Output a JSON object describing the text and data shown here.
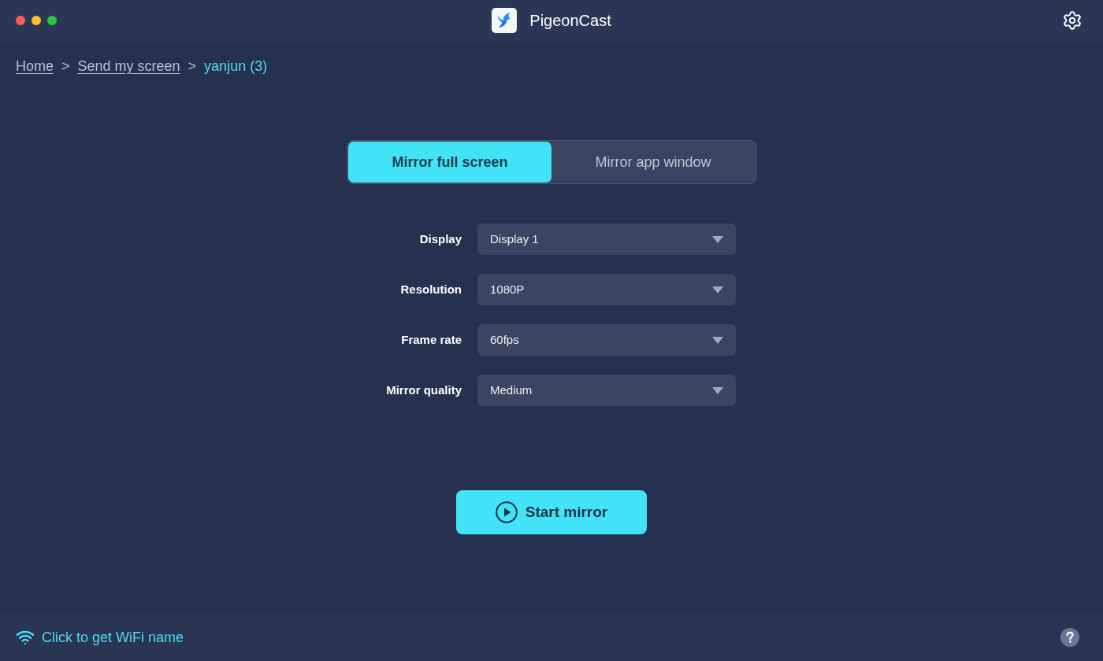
{
  "window": {
    "title": "PigeonCast"
  },
  "breadcrumb": [
    {
      "label": "Home",
      "current": false,
      "separator_after": ">"
    },
    {
      "label": "Send my screen",
      "current": false,
      "separator_after": ">"
    },
    {
      "label": "yanjun (3)",
      "current": true
    }
  ],
  "tabs": [
    {
      "label": "Mirror full screen",
      "selected": true
    },
    {
      "label": "Mirror app window",
      "selected": false
    }
  ],
  "settings": [
    {
      "label": "Display",
      "value": "Display 1"
    },
    {
      "label": "Resolution",
      "value": "1080P"
    },
    {
      "label": "Frame rate",
      "value": "60fps"
    },
    {
      "label": "Mirror quality",
      "value": "Medium"
    }
  ],
  "start_button": {
    "label": "Start mirror"
  },
  "status_bar": {
    "wifi_link": "Click to get WiFi name"
  }
}
